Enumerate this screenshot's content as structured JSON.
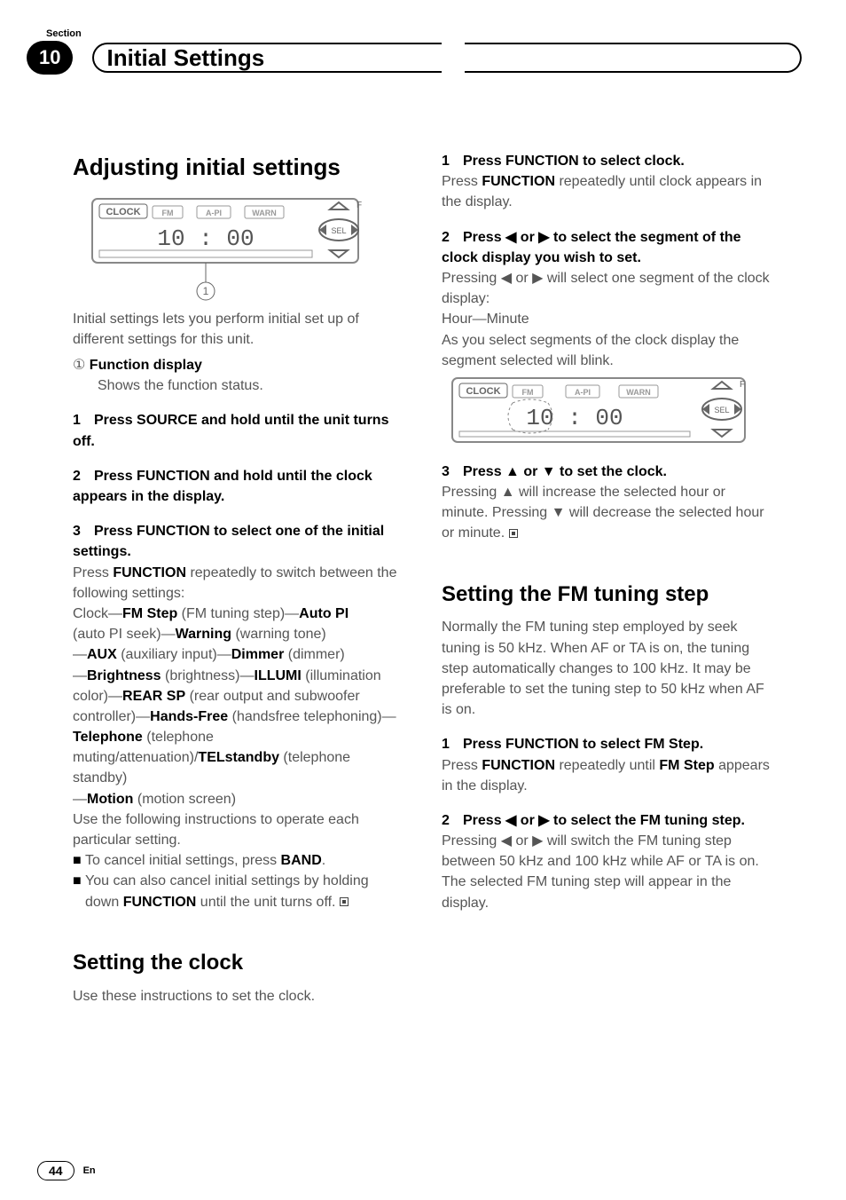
{
  "header": {
    "section_label": "Section",
    "section_number": "10",
    "title": "Initial Settings"
  },
  "left": {
    "h1": "Adjusting initial settings",
    "display_time": "10 : 00",
    "display_badges": [
      "CLOCK",
      "FM",
      "A-PI",
      "WARN"
    ],
    "callout_num": "1",
    "intro": "Initial settings lets you perform initial set up of different settings for this unit.",
    "fd_num": "①",
    "fd_label": "Function display",
    "fd_desc": "Shows the function status.",
    "s1": "Press SOURCE and hold until the unit turns off.",
    "s2": "Press FUNCTION and hold until the clock appears in the display.",
    "s3_head": "Press FUNCTION to select one of the initial settings.",
    "s3_l1a": "Press ",
    "s3_l1b": "FUNCTION",
    "s3_l1c": " repeatedly to switch between the following settings:",
    "chain1a": "Clock—",
    "chain1b": "FM Step",
    "chain1c": " (FM tuning step)—",
    "chain1d": "Auto PI",
    "chain2a": "(auto PI seek)—",
    "chain2b": "Warning",
    "chain2c": " (warning tone)",
    "chain3a": "—",
    "chain3b": "AUX",
    "chain3c": " (auxiliary input)—",
    "chain3d": "Dimmer",
    "chain3e": " (dimmer)",
    "chain4a": "—",
    "chain4b": "Brightness",
    "chain4c": " (brightness)—",
    "chain4d": "ILLUMI",
    "chain4e": " (illumination color)—",
    "chain4f": "REAR SP",
    "chain4g": " (rear output and subwoofer controller)—",
    "chain4h": "Hands-Free",
    "chain4i": " (handsfree telephoning)—",
    "chain4j": "Telephone",
    "chain4k": " (telephone muting/attenuation)/",
    "chain4l": "TELstandby",
    "chain4m": " (telephone standby)",
    "chain5a": "—",
    "chain5b": "Motion",
    "chain5c": " (motion screen)",
    "use": "Use the following instructions to operate each particular setting.",
    "b1a": "To cancel initial settings, press ",
    "b1b": "BAND",
    "b1c": ".",
    "b2a": "You can also cancel initial settings by holding down ",
    "b2b": "FUNCTION",
    "b2c": " until the unit turns off.",
    "h2": "Setting the clock",
    "h2_desc": "Use these instructions to set the clock."
  },
  "right": {
    "s1_head": "Press FUNCTION to select clock.",
    "s1a": "Press ",
    "s1b": "FUNCTION",
    "s1c": " repeatedly until clock appears in the display.",
    "s2_head": "Press ◀ or ▶ to select the segment of the clock display you wish to set.",
    "s2_body": "Pressing ◀ or ▶ will select one segment of the clock display:",
    "s2_hm": "Hour—Minute",
    "s2_tail": "As you select segments of the clock display the segment selected will blink.",
    "s3_head": "Press ▲ or ▼ to set the clock.",
    "s3_body": "Pressing ▲ will increase the selected hour or minute. Pressing ▼ will decrease the selected hour or minute.",
    "h2": "Setting the FM tuning step",
    "fm_intro": "Normally the FM tuning step employed by seek tuning is 50 kHz. When AF or TA is on, the tuning step automatically changes to 100 kHz. It may be preferable to set the tuning step to 50 kHz when AF is on.",
    "fs1_head": "Press FUNCTION to select FM Step.",
    "fs1a": "Press ",
    "fs1b": "FUNCTION",
    "fs1c": " repeatedly until ",
    "fs1d": "FM Step",
    "fs1e": " appears in the display.",
    "fs2_head": "Press ◀ or ▶ to select the FM tuning step.",
    "fs2_body": "Pressing ◀ or ▶ will switch the FM tuning step between 50 kHz and 100 kHz while AF or TA is on. The selected FM tuning step will appear in the display.",
    "display_time": "10 : 00",
    "display_badges": [
      "CLOCK",
      "FM",
      "A-PI",
      "WARN"
    ]
  },
  "footer": {
    "page": "44",
    "lang": "En"
  }
}
